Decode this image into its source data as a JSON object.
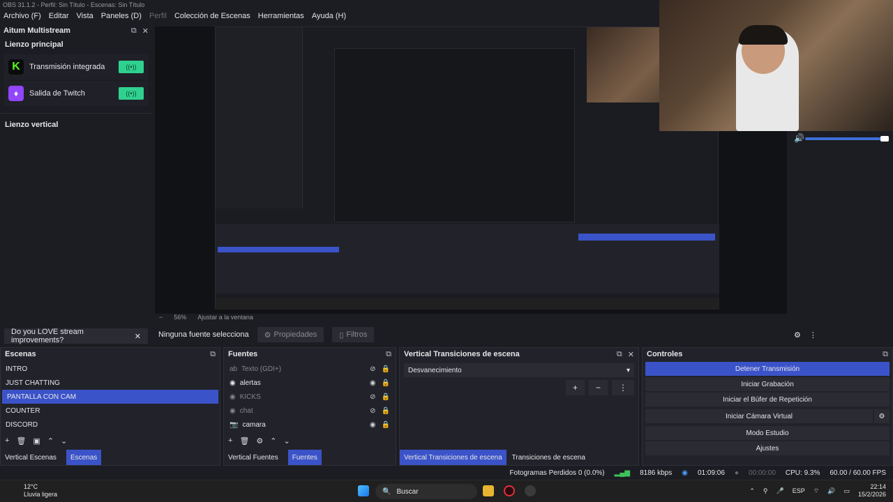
{
  "window": {
    "title": "OBS 31.1.2 - Perfil: Sin Título - Escenas: Sin Título"
  },
  "menu": [
    "Archivo (F)",
    "Editar",
    "Vista",
    "Paneles (D)",
    "Perfil",
    "Colección de Escenas",
    "Herramientas",
    "Ayuda (H)"
  ],
  "multistream": {
    "title": "Aitum Multistream",
    "section_main": "Lienzo principal",
    "outputs": [
      {
        "label": "Transmisión integrada",
        "logo": "K",
        "color": "#53fc18"
      },
      {
        "label": "Salida de Twitch",
        "logo": "♦",
        "color": "#9146ff"
      }
    ],
    "section_vertical": "Lienzo vertical",
    "promo": "Do you LOVE stream improvements?"
  },
  "preview": {
    "zoom": "56%",
    "fit": "Ajustar a la ventana"
  },
  "source_toolbar": {
    "none_selected": "Ninguna fuente selecciona",
    "properties": "Propiedades",
    "filters": "Filtros"
  },
  "scenes": {
    "title": "Escenas",
    "items": [
      "INTRO",
      "JUST CHATTING",
      "PANTALLA CON CAM",
      "COUNTER",
      "DISCORD"
    ],
    "selected_index": 2,
    "tabs": [
      "Vertical Escenas",
      "Escenas"
    ]
  },
  "sources": {
    "title": "Fuentes",
    "items": [
      {
        "label": "Texto (GDI+)",
        "icon": "ab",
        "visible": false
      },
      {
        "label": "alertas",
        "icon": "◉",
        "visible": true
      },
      {
        "label": "KICKS",
        "icon": "◉",
        "visible": false
      },
      {
        "label": "chat",
        "icon": "◉",
        "visible": false
      },
      {
        "label": "camara",
        "icon": "📷",
        "visible": true
      }
    ],
    "tabs": [
      "Vertical Fuentes",
      "Fuentes"
    ]
  },
  "transitions": {
    "title": "Vertical Transiciones de escena",
    "selected": "Desvanecimiento",
    "tabs": [
      "Vertical Transiciones de escena",
      "Transiciones de escena"
    ]
  },
  "controls": {
    "title": "Controles",
    "buttons": [
      "Detener Transmisión",
      "Iniciar Grabación",
      "Iniciar el Búfer de Repetición",
      "Iniciar Cámara Virtual",
      "Modo Estudio",
      "Ajustes"
    ]
  },
  "status": {
    "dropped": "Fotogramas Perdidos 0 (0.0%)",
    "bitrate": "8186 kbps",
    "stream_time": "01:09:06",
    "rec_time": "00:00:00",
    "cpu": "CPU: 9.3%",
    "fps": "60.00 / 60.00 FPS"
  },
  "taskbar": {
    "temp": "12°C",
    "weather": "Lluvia ligera",
    "search": "Buscar",
    "lang": "ESP",
    "time": "22:14",
    "date": "15/2/2026"
  }
}
